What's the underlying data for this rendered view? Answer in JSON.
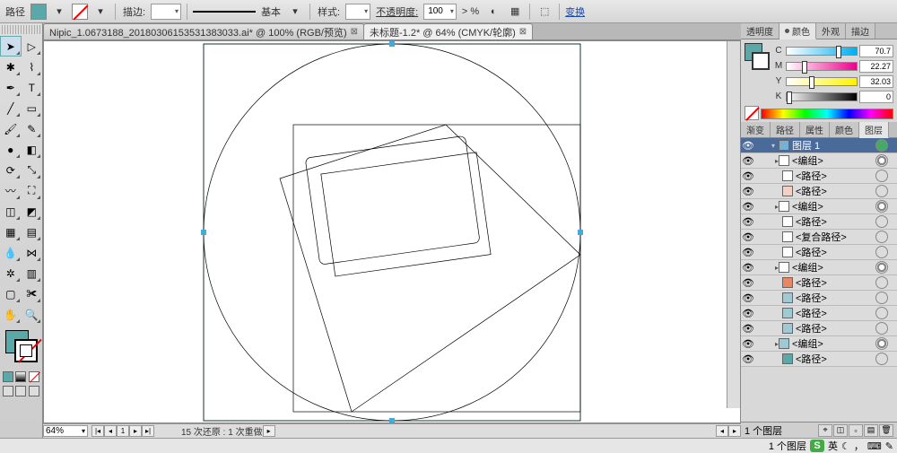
{
  "optbar": {
    "label": "路径",
    "fill_color": "#5aa8a8",
    "stroke_lbl": "描边:",
    "stroke_weight": "",
    "stroke_style_lbl": "基本",
    "style_lbl": "样式:",
    "opacity_lbl": "不透明度:",
    "opacity_val": "100",
    "opacity_pct": "> %",
    "transform_link": "变换"
  },
  "tabs": [
    {
      "label": "Nipic_1.0673188_20180306153531383033.ai* @ 100% (RGB/预览)",
      "active": false
    },
    {
      "label": "未标题-1.2* @ 64% (CMYK/轮廓)",
      "active": true
    }
  ],
  "status": {
    "zoom": "64%",
    "artboard": "1",
    "history": "15 次还原 : 1 次重做"
  },
  "color_panel": {
    "tabs": [
      "透明度",
      "颜色",
      "外观",
      "描边"
    ],
    "active": 1,
    "dot_on": 1,
    "channels": [
      {
        "label": "C",
        "val": "70.7",
        "grad": "linear-gradient(90deg,#fff,#00aeef)",
        "pos": 70.7
      },
      {
        "label": "M",
        "val": "22.27",
        "grad": "linear-gradient(90deg,#fff,#ec008c)",
        "pos": 22.27
      },
      {
        "label": "Y",
        "val": "32.03",
        "grad": "linear-gradient(90deg,#fff,#fff200)",
        "pos": 32.03
      },
      {
        "label": "K",
        "val": "0",
        "grad": "linear-gradient(90deg,#fff,#000)",
        "pos": 0
      }
    ]
  },
  "layers_panel": {
    "tabs": [
      "渐变",
      "路径",
      "属性",
      "颜色",
      "图层"
    ],
    "active": 4,
    "items": [
      {
        "depth": 0,
        "exp": "▾",
        "sw": "#77b0d4",
        "name": "图层 1",
        "sel": true,
        "tgt": "full",
        "vis": true
      },
      {
        "depth": 1,
        "exp": "▸",
        "sw": "#ffffff",
        "name": "<编组>",
        "tgt": "ring",
        "vis": true
      },
      {
        "depth": 2,
        "exp": "",
        "sw": "#ffffff",
        "name": "<路径>",
        "tgt": "o",
        "vis": true
      },
      {
        "depth": 2,
        "exp": "",
        "sw": "#f4cfc3",
        "name": "<路径>",
        "tgt": "o",
        "vis": true
      },
      {
        "depth": 1,
        "exp": "▸",
        "sw": "#ffffff",
        "name": "<编组>",
        "tgt": "ring",
        "vis": true
      },
      {
        "depth": 2,
        "exp": "",
        "sw": "#ffffff",
        "name": "<路径>",
        "tgt": "o",
        "vis": true
      },
      {
        "depth": 2,
        "exp": "",
        "sw": "#ffffff",
        "name": "<复合路径>",
        "tgt": "o",
        "vis": true
      },
      {
        "depth": 2,
        "exp": "",
        "sw": "#ffffff",
        "name": "<路径>",
        "tgt": "o",
        "vis": true
      },
      {
        "depth": 1,
        "exp": "▸",
        "sw": "#ffffff",
        "name": "<编组>",
        "tgt": "ring",
        "vis": true
      },
      {
        "depth": 2,
        "exp": "",
        "sw": "#e88862",
        "name": "<路径>",
        "tgt": "o",
        "vis": true
      },
      {
        "depth": 2,
        "exp": "",
        "sw": "#9fcad4",
        "name": "<路径>",
        "tgt": "o",
        "vis": true
      },
      {
        "depth": 2,
        "exp": "",
        "sw": "#9fcad4",
        "name": "<路径>",
        "tgt": "o",
        "vis": true
      },
      {
        "depth": 2,
        "exp": "",
        "sw": "#9fcad4",
        "name": "<路径>",
        "tgt": "o",
        "vis": true
      },
      {
        "depth": 1,
        "exp": "▸",
        "sw": "#9fcad4",
        "name": "<编组>",
        "tgt": "ring",
        "vis": true
      },
      {
        "depth": 2,
        "exp": "",
        "sw": "#5aa8a8",
        "name": "<路径>",
        "tgt": "o",
        "vis": true
      }
    ],
    "footer": "1 个图层"
  },
  "os": {
    "ime": "英"
  }
}
